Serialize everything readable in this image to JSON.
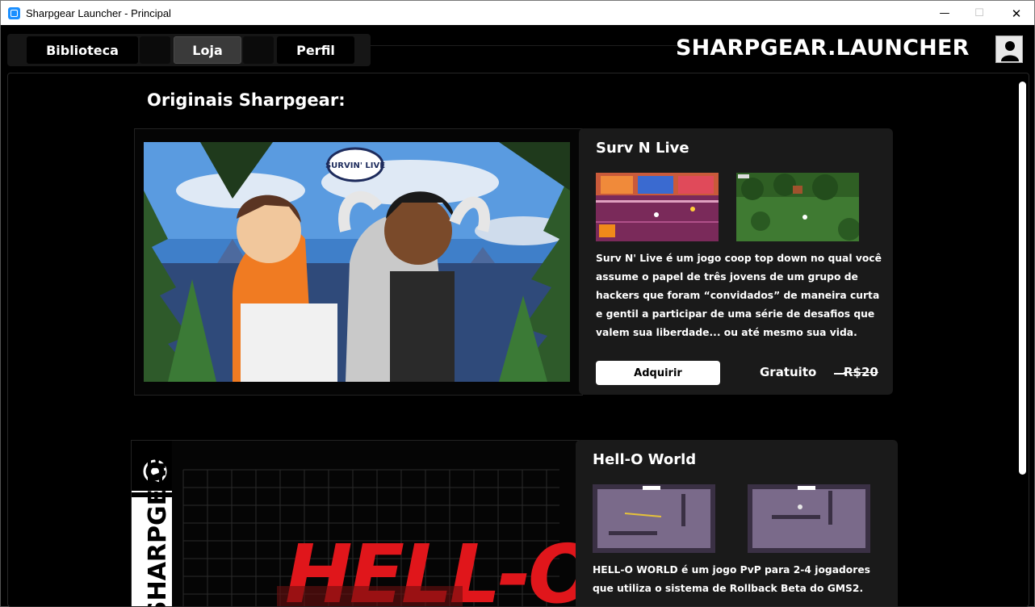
{
  "window": {
    "title": "Sharpgear Launcher - Principal",
    "minimize": "—",
    "maximize": "☐",
    "close": "✕"
  },
  "nav": {
    "tabs": [
      {
        "label": "Biblioteca",
        "active": false
      },
      {
        "label": "Loja",
        "active": true
      },
      {
        "label": "Perfil",
        "active": false
      }
    ],
    "brand": "SHARPGEAR.LAUNCHER",
    "avatar_icon": "user-icon"
  },
  "store": {
    "section_title": "Originais Sharpgear:",
    "games": [
      {
        "name": "Surv N Live",
        "cover_text": "SURVIN' LIVE",
        "description_lines": [
          "Surv N' Live é um jogo coop top down no qual você",
          "assume o papel de três jovens de um grupo de",
          "hackers que foram “convidados” de maneira curta",
          "e gentil a participar de uma série de desafios que",
          "valem sua liberdade... ou até mesmo sua vida."
        ],
        "buy_label": "Adquirir",
        "price": "Gratuito",
        "old_price": "R$20"
      },
      {
        "name": "Hell-O World",
        "cover_text": "HELL-O",
        "cover_side_text": "SHARPGEAR",
        "description_lines": [
          "HELL-O WORLD é um jogo PvP para 2-4 jogadores",
          "que utiliza o sistema de Rollback Beta do GMS2."
        ]
      }
    ]
  },
  "colors": {
    "background": "#000000",
    "panel": "#1a1a1a",
    "active_tab": "#3a3a3a",
    "accent_red": "#e0161b"
  }
}
